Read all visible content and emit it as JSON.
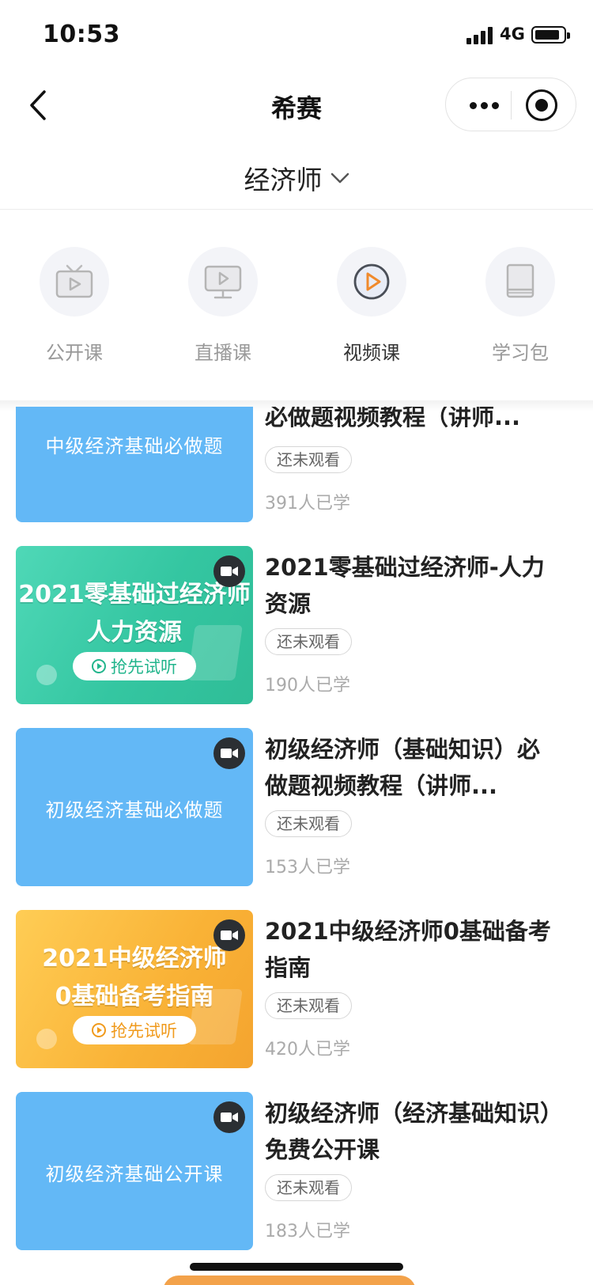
{
  "status_bar": {
    "time": "10:53",
    "network": "4G"
  },
  "nav": {
    "title": "希赛"
  },
  "category": {
    "label": "经济师"
  },
  "tabs": [
    {
      "label": "公开课",
      "icon": "tv-icon"
    },
    {
      "label": "直播课",
      "icon": "monitor-play-icon"
    },
    {
      "label": "视频课",
      "icon": "play-circle-icon"
    },
    {
      "label": "学习包",
      "icon": "book-icon"
    }
  ],
  "active_tab": "视频课",
  "colors": {
    "accent": "#f08a2c",
    "thumb_blue": "#63b8f6",
    "thumb_green": "#34c6a1",
    "thumb_orange": "#f9b236"
  },
  "courses": [
    {
      "title": "必做题视频教程（讲师...",
      "thumb_text": "中级经济基础必做题",
      "status": "还未观看",
      "count": "391人已学"
    },
    {
      "title": "2021零基础过经济师-人力资源",
      "thumb_line1": "2021零基础过经济师",
      "thumb_line2": "人力资源",
      "thumb_button": "抢先试听",
      "status": "还未观看",
      "count": "190人已学"
    },
    {
      "title": "初级经济师（基础知识）必做题视频教程（讲师...",
      "thumb_text": "初级经济基础必做题",
      "status": "还未观看",
      "count": "153人已学"
    },
    {
      "title": "2021中级经济师0基础备考指南",
      "thumb_line1": "2021中级经济师",
      "thumb_line2": "0基础备考指南",
      "thumb_button": "抢先试听",
      "status": "还未观看",
      "count": "420人已学"
    },
    {
      "title": "初级经济师（经济基础知识）免费公开课",
      "thumb_text": "初级经济基础公开课",
      "status": "还未观看",
      "count": "183人已学"
    }
  ]
}
